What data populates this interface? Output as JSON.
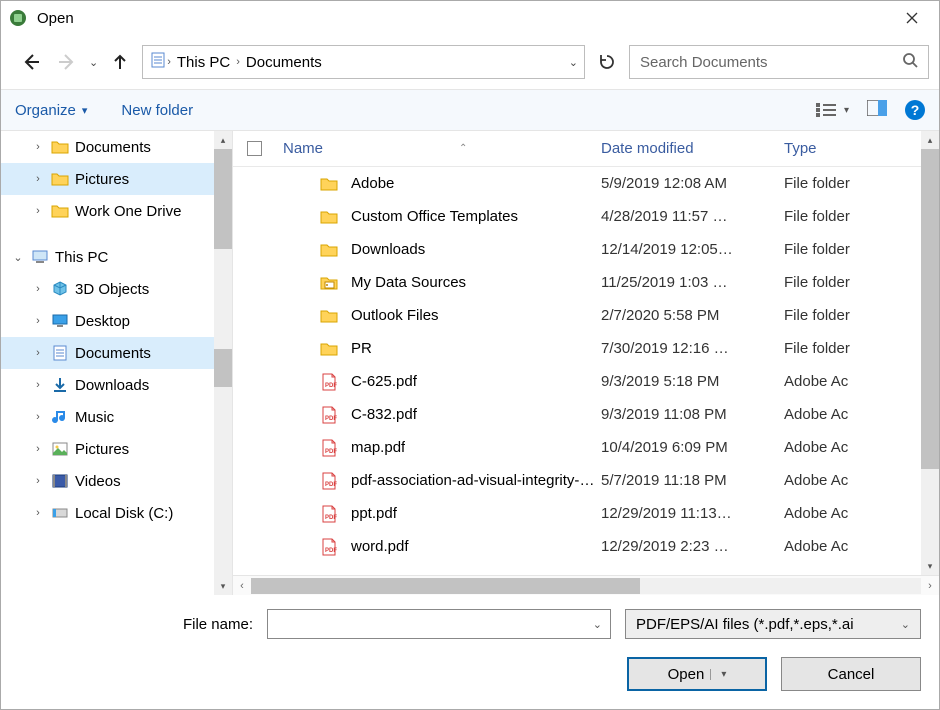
{
  "window": {
    "title": "Open"
  },
  "nav": {
    "breadcrumb": [
      "This PC",
      "Documents"
    ],
    "search_placeholder": "Search Documents"
  },
  "toolbar": {
    "organize": "Organize",
    "new_folder": "New folder"
  },
  "tree": {
    "items": [
      {
        "label": "Documents",
        "icon": "folder",
        "level": 2,
        "selected": false,
        "caret": "›"
      },
      {
        "label": "Pictures",
        "icon": "folder",
        "level": 2,
        "selected": true,
        "caret": "›"
      },
      {
        "label": "Work One Drive",
        "icon": "folder",
        "level": 2,
        "selected": false,
        "caret": "›"
      },
      {
        "label": "This PC",
        "icon": "pc",
        "level": 1,
        "selected": false,
        "caret": "⌄"
      },
      {
        "label": "3D Objects",
        "icon": "3d",
        "level": 2,
        "selected": false,
        "caret": "›"
      },
      {
        "label": "Desktop",
        "icon": "desktop",
        "level": 2,
        "selected": false,
        "caret": "›"
      },
      {
        "label": "Documents",
        "icon": "documents",
        "level": 2,
        "selected": true,
        "caret": "›"
      },
      {
        "label": "Downloads",
        "icon": "downloads",
        "level": 2,
        "selected": false,
        "caret": "›"
      },
      {
        "label": "Music",
        "icon": "music",
        "level": 2,
        "selected": false,
        "caret": "›"
      },
      {
        "label": "Pictures",
        "icon": "pictures",
        "level": 2,
        "selected": false,
        "caret": "›"
      },
      {
        "label": "Videos",
        "icon": "videos",
        "level": 2,
        "selected": false,
        "caret": "›"
      },
      {
        "label": "Local Disk (C:)",
        "icon": "disk",
        "level": 2,
        "selected": false,
        "caret": "›"
      }
    ]
  },
  "columns": {
    "name": "Name",
    "modified": "Date modified",
    "type": "Type"
  },
  "files": [
    {
      "name": "Adobe",
      "modified": "5/9/2019 12:08 AM",
      "type": "File folder",
      "icon": "folder"
    },
    {
      "name": "Custom Office Templates",
      "modified": "4/28/2019 11:57 …",
      "type": "File folder",
      "icon": "folder"
    },
    {
      "name": "Downloads",
      "modified": "12/14/2019 12:05…",
      "type": "File folder",
      "icon": "folder"
    },
    {
      "name": "My Data Sources",
      "modified": "11/25/2019 1:03 …",
      "type": "File folder",
      "icon": "folder-data"
    },
    {
      "name": "Outlook Files",
      "modified": "2/7/2020 5:58 PM",
      "type": "File folder",
      "icon": "folder"
    },
    {
      "name": "PR",
      "modified": "7/30/2019 12:16 …",
      "type": "File folder",
      "icon": "folder"
    },
    {
      "name": "C-625.pdf",
      "modified": "9/3/2019 5:18 PM",
      "type": "Adobe Ac",
      "icon": "pdf"
    },
    {
      "name": "C-832.pdf",
      "modified": "9/3/2019 11:08 PM",
      "type": "Adobe Ac",
      "icon": "pdf"
    },
    {
      "name": "map.pdf",
      "modified": "10/4/2019 6:09 PM",
      "type": "Adobe Ac",
      "icon": "pdf"
    },
    {
      "name": "pdf-association-ad-visual-integrity-20…",
      "modified": "5/7/2019 11:18 PM",
      "type": "Adobe Ac",
      "icon": "pdf"
    },
    {
      "name": "ppt.pdf",
      "modified": "12/29/2019 11:13…",
      "type": "Adobe Ac",
      "icon": "pdf"
    },
    {
      "name": "word.pdf",
      "modified": "12/29/2019 2:23 …",
      "type": "Adobe Ac",
      "icon": "pdf"
    }
  ],
  "footer": {
    "filename_label": "File name:",
    "filename_value": "",
    "filter_label": "PDF/EPS/AI files (*.pdf,*.eps,*.ai",
    "open": "Open",
    "cancel": "Cancel"
  }
}
